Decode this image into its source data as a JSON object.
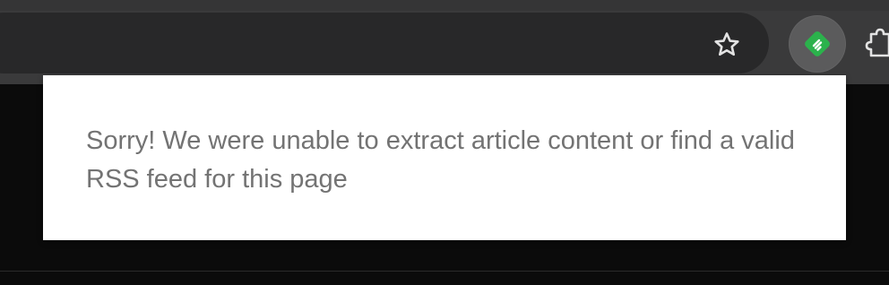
{
  "browser": {
    "bookmark_icon": "star-outline-icon",
    "extension_icon": "feedly-icon",
    "extension_color": "#2bb24c",
    "extensions_menu_icon": "puzzle-icon"
  },
  "popup": {
    "message": "Sorry! We were unable to extract article content or find a valid RSS feed for this page"
  }
}
